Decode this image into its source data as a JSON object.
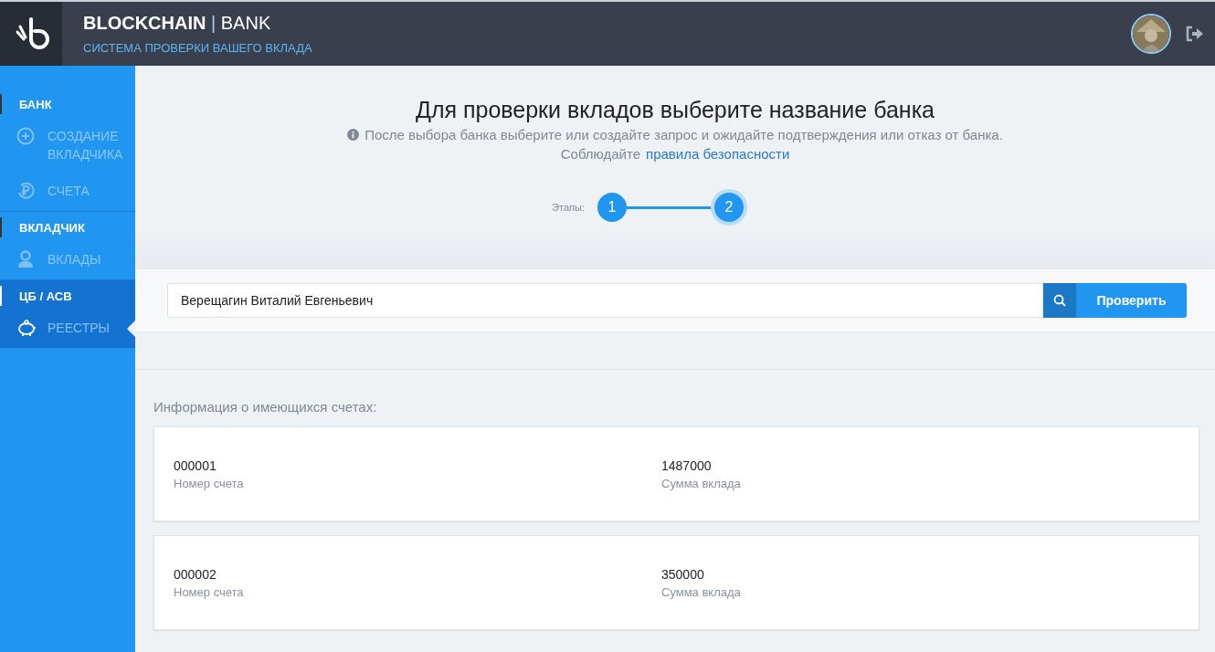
{
  "header": {
    "brand_bold": "BLOCKCHAIN",
    "separator": "|",
    "brand": "BANK",
    "subtitle": "СИСТЕМА ПРОВЕРКИ ВАШЕГО ВКЛАДА"
  },
  "sidebar": {
    "sections": [
      {
        "title": "БАНК",
        "selected": false,
        "items": [
          {
            "label": "СОЗДАНИЕ ВКЛАДЧИКА",
            "kind": "plus",
            "selected": false
          },
          {
            "label": "СЧЕТА",
            "kind": "ruble",
            "selected": false
          }
        ]
      },
      {
        "title": "ВКЛАДЧИК",
        "selected": false,
        "items": [
          {
            "label": "ВКЛАДЫ",
            "kind": "user",
            "selected": false
          }
        ]
      },
      {
        "title": "ЦБ / АСВ",
        "selected": true,
        "items": [
          {
            "label": "РЕЕСТРЫ",
            "kind": "piggy",
            "selected": true
          }
        ]
      }
    ]
  },
  "intro": {
    "title": "Для проверки вкладов выберите название банка",
    "hint": "После выбора банка выберите или создайте запрос и ожидайте подтверждения или отказ от банка.",
    "rules_prefix": "Соблюдайте",
    "rules_link": "правила безопасности"
  },
  "steps": {
    "label": "Этапы:",
    "items": [
      {
        "label": "1",
        "selected": false
      },
      {
        "label": "2",
        "selected": true
      }
    ]
  },
  "search": {
    "value": "Верещагин Виталий Евгеньевич",
    "button": "Проверить"
  },
  "accounts": {
    "title": "Информация о имеющихся счетах:",
    "rows": [
      {
        "number": "000001",
        "number_label": "Номер счета",
        "amount": "1487000",
        "amount_label": "Сумма вклада"
      },
      {
        "number": "000002",
        "number_label": "Номер счета",
        "amount": "350000",
        "amount_label": "Сумма вклада"
      }
    ]
  }
}
